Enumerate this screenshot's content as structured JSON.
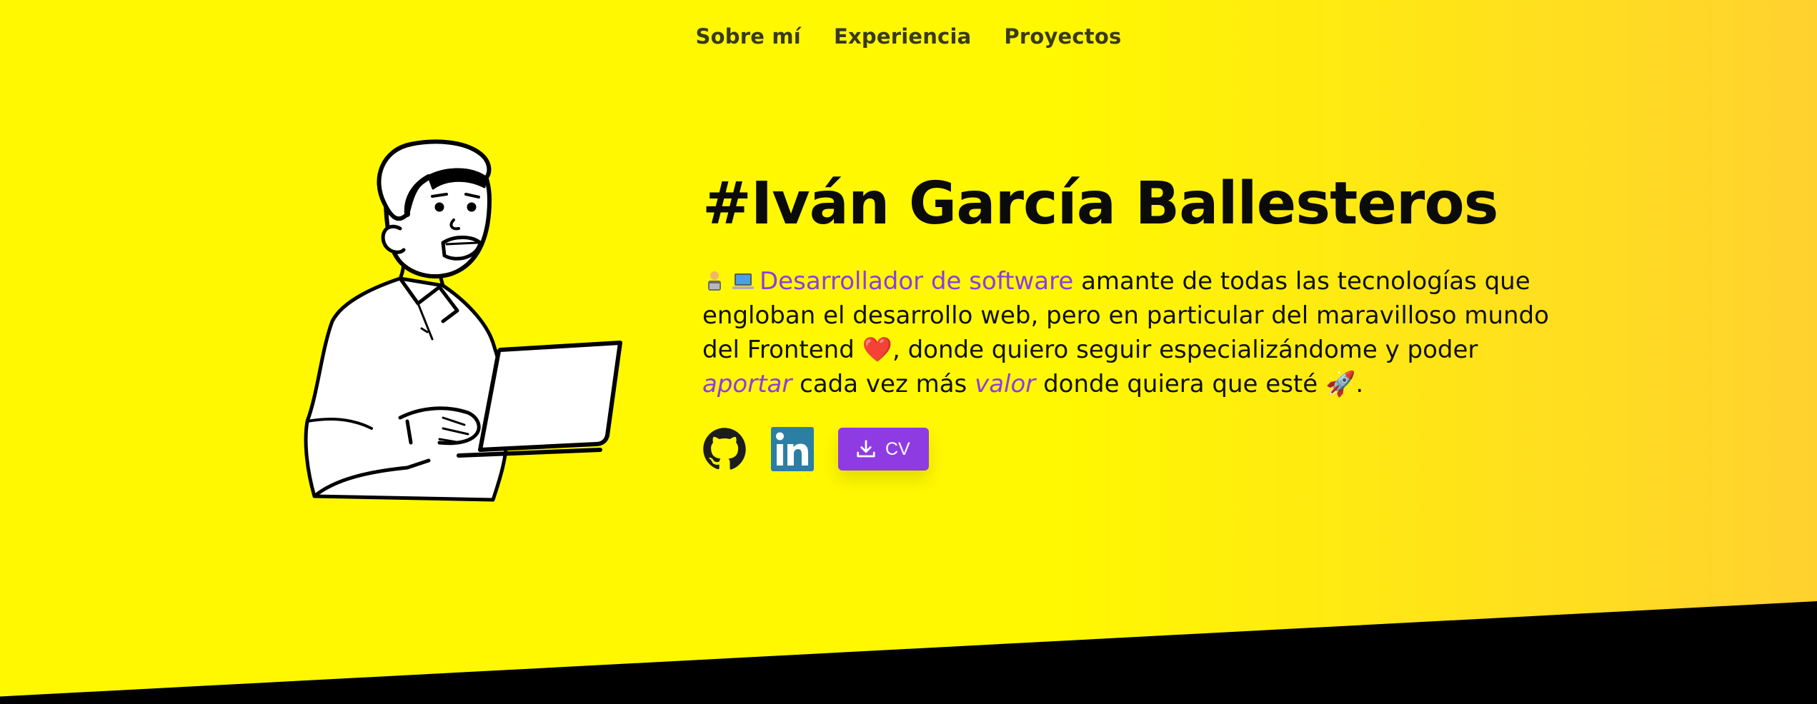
{
  "nav": {
    "items": [
      {
        "label": "Sobre mí"
      },
      {
        "label": "Experiencia"
      },
      {
        "label": "Proyectos"
      }
    ]
  },
  "hero": {
    "title": "#Iván García Ballesteros",
    "bio": {
      "emojis": [
        "person-technologist-emoji",
        "laptop-emoji"
      ],
      "highlight": "Desarrollador de software",
      "text_1": " amante de todas las tecnologías que engloban el desarrollo web, pero en particular del maravilloso mundo del Frontend ",
      "heart": "❤️",
      "text_2": ", donde quiero seguir especializándome y poder ",
      "aportar": "aportar",
      "text_3": " cada vez más ",
      "valor": "valor",
      "text_4": " donde quiera que esté ",
      "rocket": "🚀",
      "text_5": "."
    },
    "social": {
      "github_icon": "github-icon",
      "linkedin_icon": "linkedin-icon",
      "cv_label": "CV",
      "cv_icon": "download-icon"
    }
  },
  "colors": {
    "background_start": "#fff800",
    "background_end": "#ffd12f",
    "accent": "#8e3be4",
    "linkedin": "#2b7fa3",
    "bottom_band": "#000000"
  }
}
